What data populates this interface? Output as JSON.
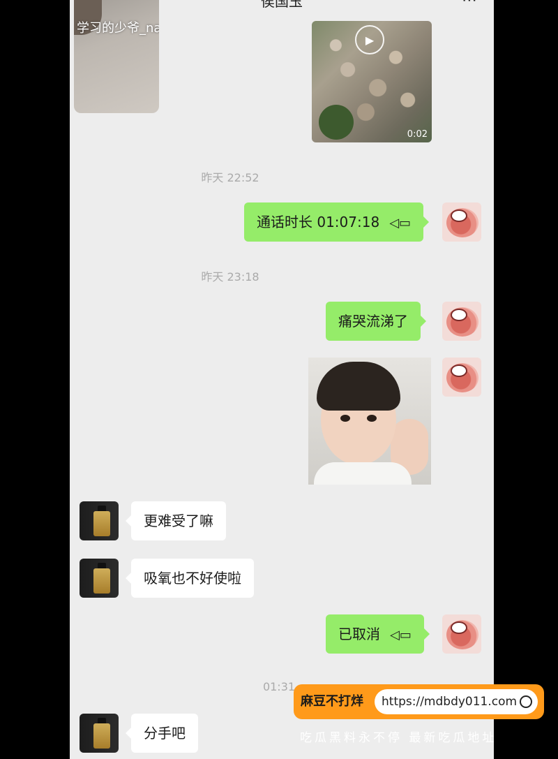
{
  "header": {
    "title": "侯国玉",
    "more_icon": "⋯"
  },
  "top_media": {
    "watermark": "学习的少爷_na"
  },
  "video": {
    "duration": "0:02"
  },
  "timestamps": [
    "昨天 22:52",
    "昨天 23:18",
    "01:31"
  ],
  "messages": [
    {
      "from": "me",
      "text": "通话时长 01:07:18",
      "icon": "video-call-icon"
    },
    {
      "from": "me",
      "text": "痛哭流涕了"
    },
    {
      "from": "other",
      "text": "更难受了嘛"
    },
    {
      "from": "other",
      "text": "吸氧也不好使啦"
    },
    {
      "from": "me",
      "text": "已取消",
      "icon": "video-call-icon"
    },
    {
      "from": "other",
      "text": "分手吧"
    }
  ],
  "overlay": {
    "brand": "麻豆不打烊",
    "url": "https://mdbdy011.com",
    "slogan": "吃瓜黑料永不停 最新吃瓜地址"
  }
}
